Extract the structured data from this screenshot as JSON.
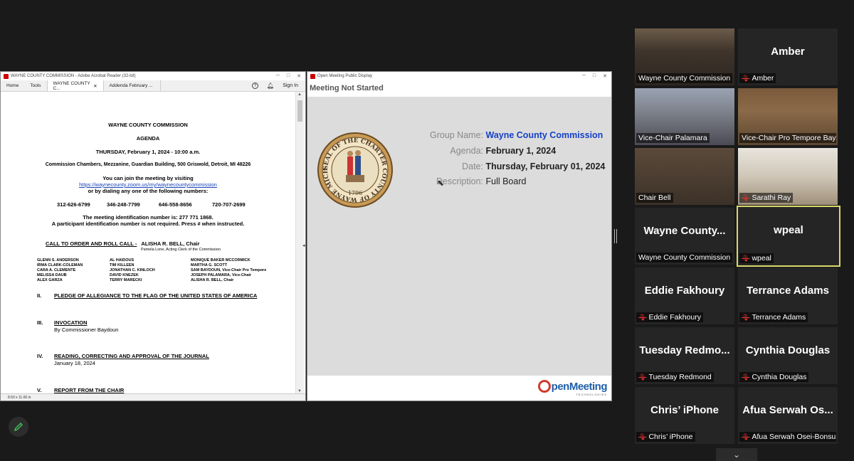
{
  "acrobat": {
    "title": "WAYNE COUNTY COMMISSION - Adobe Acrobat Reader (32-bit)",
    "tab_home": "Home",
    "tab_tools": "Tools",
    "tab_doc1": "WAYNE COUNTY C...",
    "tab_doc2": "Addenda February ...",
    "sign_in": "Sign In",
    "page_size": "8.50 x 11.00 in",
    "doc": {
      "org": "WAYNE COUNTY COMMISSION",
      "agenda": "AGENDA",
      "date": "THURSDAY, February 1, 2024 - 10:00 a.m.",
      "location": "Commission Chambers, Mezzanine, Guardian Building, 500 Griswold, Detroit, MI 48226",
      "join_line": "You can join the meeting by visiting",
      "zoom_link": "https://waynecounty.zoom.us/my/waynecountycommission",
      "dial_line": "or by dialing any one of the following numbers:",
      "phones": [
        "312-626-6799",
        "346-248-7799",
        "646-558-8656",
        "720-707-2699"
      ],
      "meeting_id": "The meeting identification number is: 277 771 1868.",
      "participant": "A participant identification number is not required. Press # when instructed.",
      "call_to_order": "CALL TO ORDER AND ROLL CALL -",
      "chair": "ALISHA R. BELL, Chair",
      "clerk": "Pamela Lone, Acting Clerk of the Commission",
      "roll_col1": [
        "GLENN S. ANDERSON",
        "IRMA CLARK-COLEMAN",
        "CARA A. CLEMENTE",
        "MELISSA DAUB",
        "ALEX GARZA"
      ],
      "roll_col2": [
        "AL HAIDOUS",
        "TIM KILLEEN",
        "JONATHAN C. KINLOCH",
        "DAVID KNEZEK",
        "TERRY MARECKI"
      ],
      "roll_col3": [
        "MONIQUE BAKER MCCORMICK",
        "MARTHA G. SCOTT",
        "SAM BAYDOUN, Vice-Chair Pro Tempore",
        "JOSEPH PALAMARA, Vice-Chair",
        "ALISHA R. BELL, Chair"
      ],
      "sec2_num": "II.",
      "sec2_title": "PLEDGE OF ALLEGIANCE TO THE FLAG OF THE UNITED STATES OF AMERICA",
      "sec3_num": "III.",
      "sec3_title": "INVOCATION",
      "sec3_sub": "By Commissioner Baydoun",
      "sec4_num": "IV.",
      "sec4_title": "READING, CORRECTING AND APPROVAL OF THE JOURNAL",
      "sec4_sub": "January 18, 2024",
      "sec5_num": "V.",
      "sec5_title": "REPORT FROM THE CHAIR"
    }
  },
  "openmeeting": {
    "title": "Open Meeting Public Display",
    "status": "Meeting Not Started",
    "group_label": "Group Name:",
    "group_value": "Wayne County Commission",
    "agenda_label": "Agenda:",
    "agenda_value": "February 1, 2024",
    "date_label": "Date:",
    "date_value": "Thursday, February 01, 2024",
    "desc_label": "Description:",
    "desc_value": "Full Board",
    "brand": "penMeeting",
    "brand_tm": "TECHNOLOGIES",
    "seal_text": "SEAL OF THE CHARTER COUNTY OF WAYNE MICHIGAN",
    "seal_year": "1796"
  },
  "gallery": [
    {
      "name": "",
      "label": "Wayne County Commission",
      "muted": false,
      "video": "room"
    },
    {
      "name": "Amber",
      "label": "Amber",
      "muted": true,
      "video": ""
    },
    {
      "name": "",
      "label": "Vice-Chair Palamara",
      "muted": false,
      "video": "man"
    },
    {
      "name": "",
      "label": "Vice-Chair Pro Tempore Bay...",
      "muted": false,
      "video": "man2"
    },
    {
      "name": "",
      "label": "Chair Bell",
      "muted": false,
      "video": "seal"
    },
    {
      "name": "",
      "label": "Sarathi Ray",
      "muted": true,
      "video": "sarathi"
    },
    {
      "name": "Wayne  County...",
      "label": "Wayne County Commission",
      "muted": false,
      "video": ""
    },
    {
      "name": "wpeal",
      "label": "wpeal",
      "muted": true,
      "video": "",
      "active": true
    },
    {
      "name": "Eddie Fakhoury",
      "label": "Eddie Fakhoury",
      "muted": true,
      "video": ""
    },
    {
      "name": "Terrance Adams",
      "label": "Terrance Adams",
      "muted": true,
      "video": ""
    },
    {
      "name": "Tuesday  Redmo...",
      "label": "Tuesday Redmond",
      "muted": true,
      "video": ""
    },
    {
      "name": "Cynthia Douglas",
      "label": "Cynthia Douglas",
      "muted": true,
      "video": ""
    },
    {
      "name": "Chris’ iPhone",
      "label": "Chris’ iPhone",
      "muted": true,
      "video": ""
    },
    {
      "name": "Afua Serwah Os...",
      "label": "Afua Serwah Osei-Bonsu",
      "muted": true,
      "video": ""
    }
  ],
  "icons": {
    "muted_mic": "mic-off-icon",
    "pen": "pen-icon",
    "chevron": "chevron-down-icon"
  },
  "colors": {
    "group_name_blue": "#1540c8",
    "active_speaker_border": "#d9d96b",
    "muted_red": "#e0332f"
  }
}
